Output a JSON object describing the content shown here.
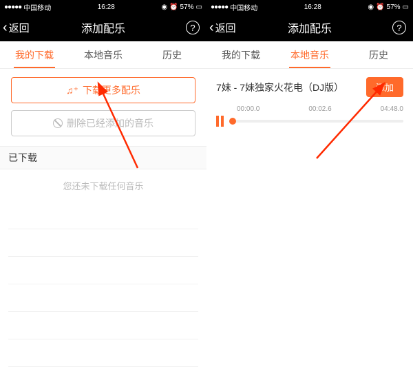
{
  "status": {
    "carrier": "中国移动",
    "time": "16:28",
    "alarm": "⏰",
    "battery_pct": "57%"
  },
  "nav": {
    "back": "返回",
    "title": "添加配乐",
    "help": "?"
  },
  "tabs": {
    "downloads": "我的下载",
    "local": "本地音乐",
    "history": "历史"
  },
  "left": {
    "download_more": "下载更多配乐",
    "delete_added": "删除已经添加的音乐",
    "section": "已下载",
    "empty": "您还未下载任何音乐"
  },
  "right": {
    "song": "7妹 - 7妹独家火花电（DJ版）",
    "add": "添加",
    "t_start": "00:00.0",
    "t_cur": "00:02.6",
    "t_end": "04:48.0",
    "progress_pct": 1
  }
}
